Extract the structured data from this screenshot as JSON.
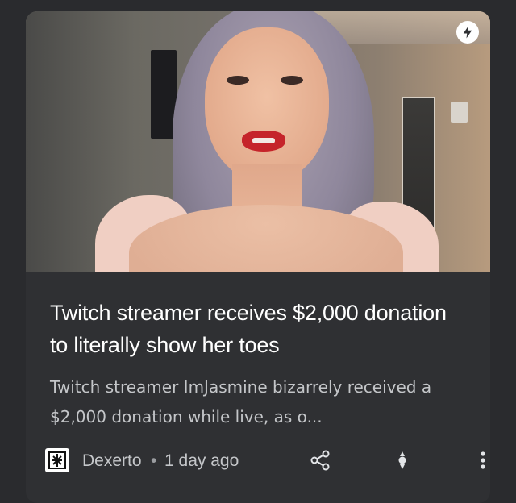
{
  "article": {
    "title": "Twitch streamer receives $2,000 donation to literally show her toes",
    "snippet": "Twitch streamer ImJasmine bizarrely received a $2,000 donation while live, as o...",
    "source": "Dexerto",
    "separator": "•",
    "time": "1 day ago"
  },
  "icons": {
    "amp": "lightning-bolt-icon",
    "publisher_logo": "dexerto-logo",
    "share": "share-icon",
    "interest": "interest-control-icon",
    "more": "more-vertical-icon"
  },
  "colors": {
    "background": "#2a2b2e",
    "card": "#2f3033",
    "title_text": "#ffffff",
    "secondary_text": "#c4c6c9"
  }
}
